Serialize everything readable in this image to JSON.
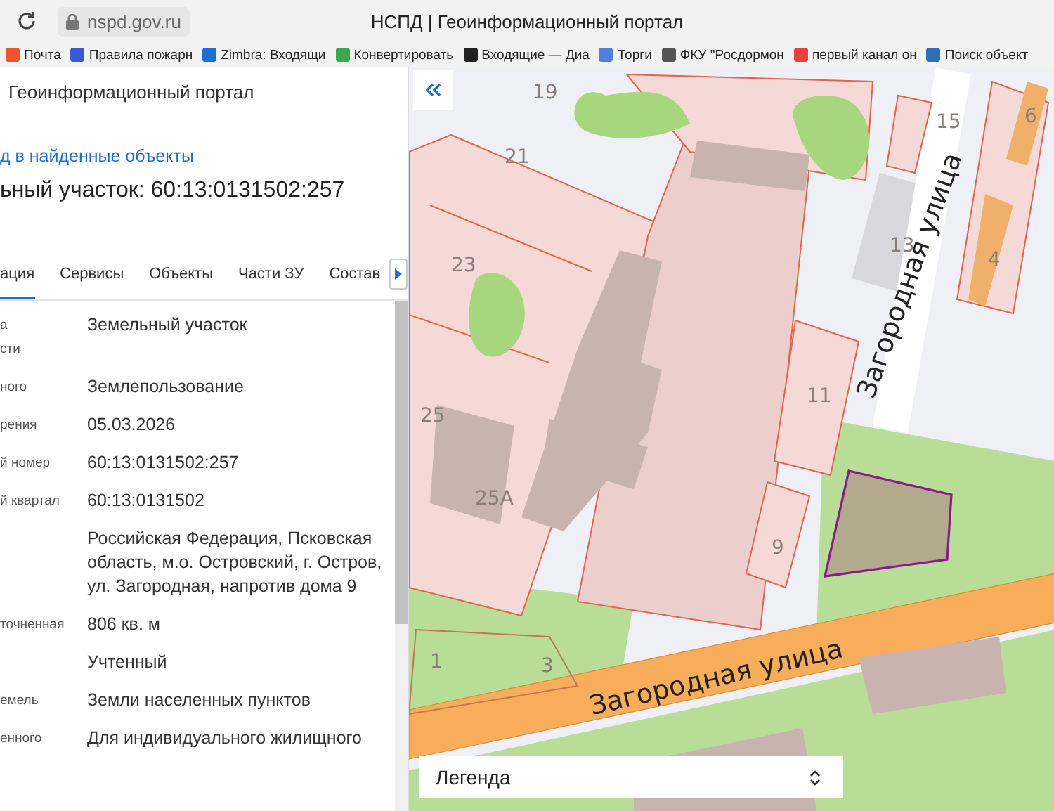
{
  "browser": {
    "url": "nspd.gov.ru",
    "title": "НСПД | Геоинформационный портал",
    "bookmarks": [
      {
        "label": "Почта",
        "color": "#f0562b"
      },
      {
        "label": "Правила пожарн",
        "color": "#3b5bd6"
      },
      {
        "label": "Zimbra: Входящи",
        "color": "#1f6fd1"
      },
      {
        "label": "Конвертировать",
        "color": "#3aa84b"
      },
      {
        "label": "Входящие — Диа",
        "color": "#222222"
      },
      {
        "label": "Торги",
        "color": "#4f7fe0"
      },
      {
        "label": "ФКУ \"Росдормон",
        "color": "#555555"
      },
      {
        "label": "первый канал он",
        "color": "#e8413b"
      },
      {
        "label": "Поиск объект",
        "color": "#2f6fb5"
      }
    ]
  },
  "panel": {
    "header": "Геоинформационный портал",
    "back_link": "д в найденные объекты",
    "title": "ьный участок: 60:13:0131502:257",
    "tabs": [
      {
        "label": "ация",
        "selected": true
      },
      {
        "label": "Сервисы",
        "selected": false
      },
      {
        "label": "Объекты",
        "selected": false
      },
      {
        "label": "Части ЗУ",
        "selected": false
      },
      {
        "label": "Состав",
        "selected": false
      }
    ],
    "rows": [
      {
        "label": [
          "а",
          "сти"
        ],
        "value": [
          "Земельный участок"
        ]
      },
      {
        "label": [
          "ного"
        ],
        "value": [
          "Землепользование"
        ]
      },
      {
        "label": [
          "рения"
        ],
        "value": [
          "05.03.2026"
        ]
      },
      {
        "label": [
          "й номер"
        ],
        "value": [
          "60:13:0131502:257"
        ]
      },
      {
        "label": [
          "й квартал"
        ],
        "value": [
          "60:13:0131502"
        ]
      },
      {
        "label": [],
        "value": [
          "Российская Федерация, Псковская",
          "область, м.о. Островский, г. Остров,",
          "ул. Загородная, напротив дома 9"
        ]
      },
      {
        "label": [
          "точненная"
        ],
        "value": [
          "806 кв. м"
        ]
      },
      {
        "label": [],
        "value": [
          "Учтенный"
        ]
      },
      {
        "label": [
          "емель"
        ],
        "value": [
          "Земли населенных пунктов"
        ]
      },
      {
        "label": [
          "енного"
        ],
        "value": [
          "Для индивидуального жилищного"
        ]
      }
    ]
  },
  "map": {
    "house_numbers": [
      "19",
      "21",
      "23",
      "25",
      "25А",
      "1",
      "3",
      "9",
      "11",
      "13",
      "15",
      "6",
      "4"
    ],
    "streets": [
      "Загородная  улица",
      "Загородная  улица"
    ],
    "legend": "Легенда"
  }
}
